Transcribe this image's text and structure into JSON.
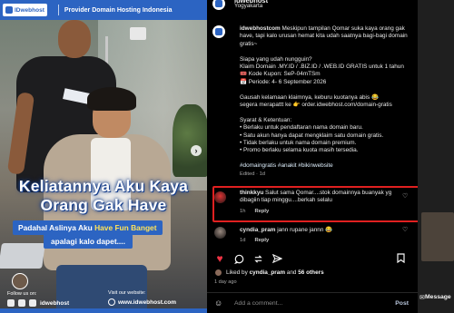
{
  "media": {
    "brand": "IDwebhost",
    "tagline": "Provider Domain Hosting Indonesia",
    "headline": "Keliatannya Aku Kaya Orang Gak Have",
    "subtitle_pre": "Padahal Aslinya Aku ",
    "subtitle_highlight": "Have Fun Banget",
    "subtitle_line2": "apalagi kalo dapet....",
    "follow_label": "Follow us on:",
    "handle": "idwebhost",
    "visit_label": "Visit our website:",
    "website": "www.idwebhost.com"
  },
  "post": {
    "account": "idwebhost",
    "location": "Yogyakarta",
    "caption": {
      "author": "idwebhostcom",
      "p1": " Meskipun tampilan Qomar suka kaya orang gak have, tapi kalo urusan hemat kita udah saatnya bagi-bagi domain gratis~",
      "p2_l1": "Siapa yang udah nungguin?",
      "p2_l2": "Klaim Domain .MY.ID / .BIZ.ID / .WEB.ID GRATIS untuk 1 tahun",
      "p2_l3": "🎟️ Kode Kupon: SeP-04mTSm",
      "p2_l4": "📅 Periode: 4- 6 September 2026",
      "p3_l1": "Gausah kelamaan klaimnya, keburu kuotanya abis 😂",
      "p3_l2": "segera merapattt ke 👉 order.idwebhost.com/domain-gratis",
      "p4_l1": "Syarat & Ketentuan:",
      "p4_l2": "• Berlaku untuk pendaftaran nama domain baru.",
      "p4_l3": "• Satu akun hanya dapat mengklaim satu domain gratis.",
      "p4_l4": "• Tidak berlaku untuk nama domain premium.",
      "p4_l5": "• Promo berlaku selama kuota masih tersedia.",
      "tags": "#domaingratis #anakit #bikinwebsite",
      "edited": "Edited · 1d"
    },
    "comments": [
      {
        "user": "thinkkyu",
        "text": " Salut sama Qomar....stok domainnya buanyak yg dibagiin tiap minggu....berkah selalu",
        "age": "1h",
        "reply": "Reply"
      },
      {
        "user": "cyndia_pram",
        "text": " jann rupane jannn 😂",
        "age": "1d",
        "reply": "Reply"
      }
    ],
    "likes": {
      "prefix": "Liked by ",
      "user": "cyndia_pram",
      "mid": " and ",
      "others": "56 others"
    },
    "date": "1 day ago",
    "add_comment_placeholder": "Add a comment...",
    "post_button": "Post"
  },
  "strip": {
    "message_label": "Message"
  },
  "colors": {
    "brand_blue": "#2c64c2",
    "highlight_yellow": "#ffe35a",
    "comment_highlight_border": "#e02020",
    "like_red": "#ee3344"
  },
  "icons": [
    "heart-icon",
    "comment-icon",
    "share-icon",
    "send-icon",
    "bookmark-icon",
    "emoji-icon",
    "chevron-right-icon"
  ]
}
